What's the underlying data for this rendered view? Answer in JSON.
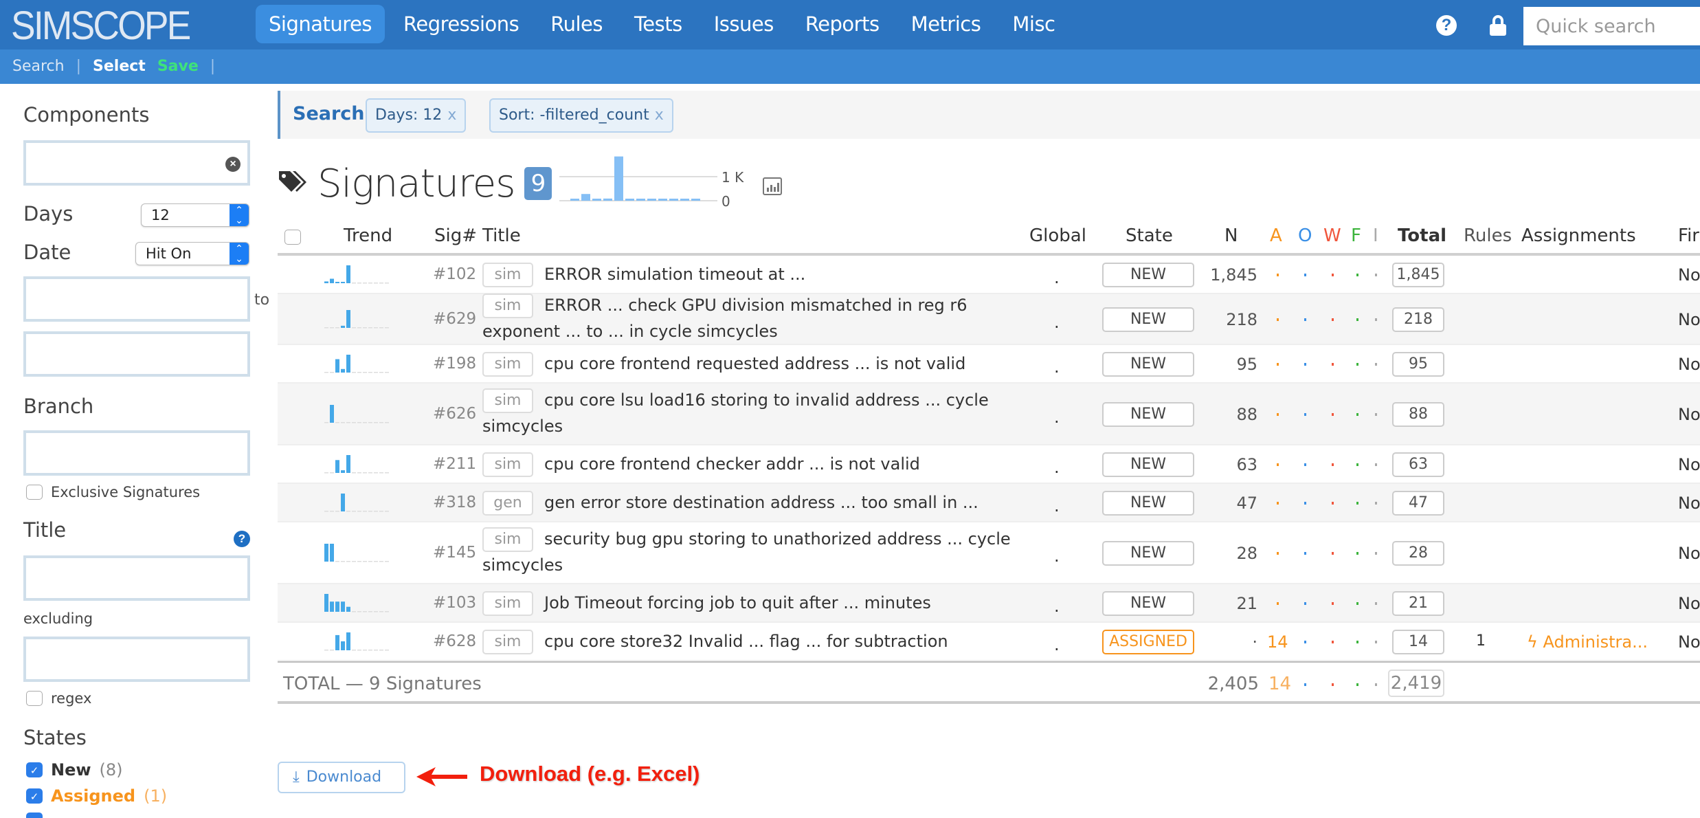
{
  "app": {
    "brand": "SIMSCOPE",
    "nav": [
      {
        "label": "Signatures",
        "active": true
      },
      {
        "label": "Regressions"
      },
      {
        "label": "Rules"
      },
      {
        "label": "Tests"
      },
      {
        "label": "Issues"
      },
      {
        "label": "Reports"
      },
      {
        "label": "Metrics"
      },
      {
        "label": "Misc"
      }
    ],
    "help_icon": "question-circle-icon",
    "lock_icon": "lock-icon",
    "quick_search_placeholder": "Quick search"
  },
  "subnav": {
    "search": "Search",
    "sep1": "|",
    "select": "Select",
    "save": "Save",
    "sep2": "|"
  },
  "sidebar": {
    "components_label": "Components",
    "components_value": "",
    "days_label": "Days",
    "days_value": "12",
    "date_label": "Date",
    "date_value": "Hit On",
    "date_from": "",
    "date_to_label": "to",
    "date_to": "",
    "branch_label": "Branch",
    "branch_value": "",
    "exclusive_label": "Exclusive Signatures",
    "exclusive_checked": false,
    "title_label": "Title",
    "title_value": "",
    "excluding_label": "excluding",
    "excluding_value": "",
    "regex_label": "regex",
    "regex_checked": false,
    "states_label": "States",
    "states": [
      {
        "name": "New",
        "count": "(8)",
        "checked": true
      },
      {
        "name": "Assigned",
        "count": "(1)",
        "checked": true
      }
    ]
  },
  "filters": {
    "label": "Search",
    "chips": [
      {
        "text": "Days:  12",
        "x": "x"
      },
      {
        "text": "Sort:  -filtered_count",
        "x": "x"
      }
    ]
  },
  "page": {
    "title": "Signatures",
    "count": "9",
    "summary_chart": {
      "axis_labels": [
        "1 K",
        "0"
      ],
      "daily_counts": [
        60,
        280,
        60,
        90,
        1840,
        0,
        0,
        0,
        0,
        0,
        0,
        0
      ],
      "reference_line": 1000
    }
  },
  "table": {
    "headers": {
      "trend": "Trend",
      "sig": "Sig#",
      "title": "Title",
      "global": "Global",
      "state": "State",
      "n": "N",
      "a": "A",
      "o": "O",
      "w": "W",
      "f": "F",
      "i": "I",
      "total": "Total",
      "rules": "Rules",
      "assignments": "Assignments",
      "first": "Fir"
    },
    "colors": {
      "a": "#f7941d",
      "o": "#3a8fe6",
      "w": "#f0563c",
      "f": "#3cb43c",
      "i": "#aaaaaa",
      "trend_bar": "#44a8e8",
      "assigned": "#f7941d"
    },
    "rows": [
      {
        "sig": "#102",
        "kind": "sim",
        "title": "ERROR simulation timeout at ...",
        "global": ".",
        "state": "NEW",
        "n": "1,845",
        "a": "",
        "total": "1,845",
        "rules": "",
        "assignment": "",
        "first": "No",
        "trend": [
          0.1,
          0.25,
          0.06,
          0.06,
          1,
          0,
          0,
          0,
          0,
          0,
          0,
          0
        ]
      },
      {
        "sig": "#629",
        "kind": "sim",
        "title": "ERROR ... check GPU division mismatched in reg r6 exponent ... to ... in cycle simcycles",
        "global": ".",
        "state": "NEW",
        "n": "218",
        "a": "",
        "total": "218",
        "rules": "",
        "assignment": "",
        "first": "No",
        "trend": [
          0,
          0,
          0,
          0.12,
          1,
          0,
          0,
          0,
          0,
          0,
          0,
          0
        ]
      },
      {
        "sig": "#198",
        "kind": "sim",
        "title": "cpu core frontend requested address ... is not valid",
        "global": ".",
        "state": "NEW",
        "n": "95",
        "a": "",
        "total": "95",
        "rules": "",
        "assignment": "",
        "first": "No",
        "trend": [
          0,
          0,
          0.75,
          0.2,
          1,
          0,
          0,
          0,
          0,
          0,
          0,
          0
        ]
      },
      {
        "sig": "#626",
        "kind": "sim",
        "title": "cpu core lsu load16 storing to invalid address ... cycle simcycles",
        "global": ".",
        "state": "NEW",
        "n": "88",
        "a": "",
        "total": "88",
        "rules": "",
        "assignment": "",
        "first": "No",
        "trend": [
          0,
          1,
          0,
          0,
          0,
          0,
          0,
          0,
          0,
          0,
          0,
          0
        ]
      },
      {
        "sig": "#211",
        "kind": "sim",
        "title": "cpu core frontend checker addr ... is not valid",
        "global": ".",
        "state": "NEW",
        "n": "63",
        "a": "",
        "total": "63",
        "rules": "",
        "assignment": "",
        "first": "No",
        "trend": [
          0,
          0,
          0.72,
          0.15,
          1,
          0,
          0,
          0,
          0,
          0,
          0,
          0
        ]
      },
      {
        "sig": "#318",
        "kind": "gen",
        "title": "gen error store destination address ... too small in ...",
        "global": ".",
        "state": "NEW",
        "n": "47",
        "a": "",
        "total": "47",
        "rules": "",
        "assignment": "",
        "first": "No",
        "trend": [
          0,
          0,
          0,
          1,
          0,
          0,
          0,
          0,
          0,
          0,
          0,
          0
        ]
      },
      {
        "sig": "#145",
        "kind": "sim",
        "title": "security bug gpu storing to unathorized address ... cycle simcycles",
        "global": ".",
        "state": "NEW",
        "n": "28",
        "a": "",
        "total": "28",
        "rules": "",
        "assignment": "",
        "first": "No",
        "trend": [
          1,
          1,
          0,
          0,
          0,
          0,
          0,
          0,
          0,
          0,
          0,
          0
        ]
      },
      {
        "sig": "#103",
        "kind": "sim",
        "title": "Job Timeout forcing job to quit after ... minutes",
        "global": ".",
        "state": "NEW",
        "n": "21",
        "a": "",
        "total": "21",
        "rules": "",
        "assignment": "",
        "first": "No",
        "trend": [
          1,
          0.57,
          0.57,
          0.57,
          0.28,
          0,
          0,
          0,
          0,
          0,
          0,
          0
        ]
      },
      {
        "sig": "#628",
        "kind": "sim",
        "title": "cpu core store32 Invalid ... flag ... for subtraction",
        "global": ".",
        "state": "ASSIGNED",
        "n": "·",
        "a": "14",
        "total": "14",
        "rules": "1",
        "assignment": "Administra...",
        "first": "No",
        "trend": [
          0,
          0,
          0.85,
          0.5,
          1,
          0,
          0,
          0,
          0,
          0,
          0,
          0
        ]
      }
    ],
    "footer": {
      "label": "TOTAL — 9 Signatures",
      "n": "2,405",
      "a": "14",
      "total": "2,419"
    }
  },
  "actions": {
    "download_label": "Download",
    "annotation": "Download (e.g. Excel)"
  }
}
